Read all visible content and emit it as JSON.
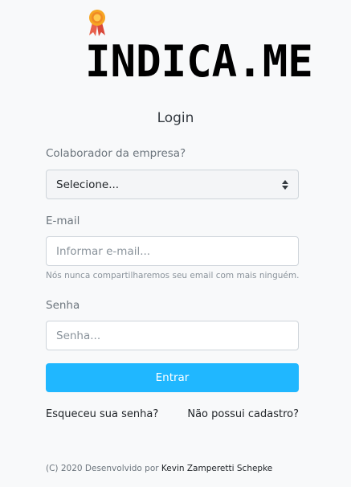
{
  "brand": {
    "logo_text": "INDICA.ME",
    "medal_icon": "award-medal-icon",
    "medal_colors": {
      "ribbon": "#e8604c",
      "medal": "#f6a623"
    }
  },
  "login": {
    "title": "Login",
    "company": {
      "label": "Colaborador da empresa?",
      "selected": "Selecione..."
    },
    "email": {
      "label": "E-mail",
      "placeholder": "Informar e-mail...",
      "help": "Nós nunca compartilharemos seu email com mais ninguém."
    },
    "password": {
      "label": "Senha",
      "placeholder": "Senha..."
    },
    "submit_label": "Entrar",
    "forgot_link": "Esqueceu sua senha?",
    "register_link": "Não possui cadastro?"
  },
  "footer": {
    "prefix": "(C) 2020 Desenvolvido por",
    "author": "Kevin Zamperetti Schepke"
  },
  "colors": {
    "accent": "#20b7ff",
    "background": "#f8f9fa"
  }
}
